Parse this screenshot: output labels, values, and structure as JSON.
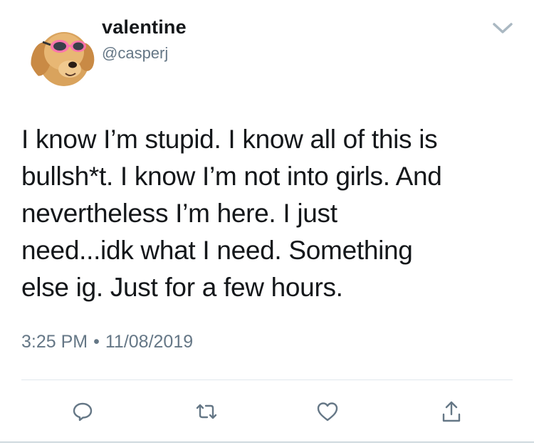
{
  "user": {
    "display_name": "valentine",
    "handle": "@casperj",
    "avatar_icon": "golden-retriever-with-pink-goggles"
  },
  "tweet": {
    "text": "I know I’m stupid. I know all of this is\nbullsh*t. I know I’m not into girls. And\nnevertheless I’m here. I just\nneed...idk what I need. Something\nelse ig. Just for a few hours.",
    "time": "3:25 PM",
    "separator": "•",
    "date": "11/08/2019"
  },
  "actions": {
    "reply_icon": "reply-icon",
    "retweet_icon": "retweet-icon",
    "like_icon": "heart-icon",
    "share_icon": "share-icon"
  },
  "colors": {
    "text_primary": "#14171a",
    "text_secondary": "#657786",
    "icon": "#657786",
    "divider": "#e1e8ed"
  }
}
